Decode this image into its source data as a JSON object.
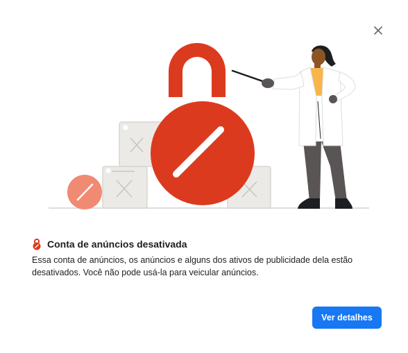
{
  "dialog": {
    "close_icon": "close-icon",
    "title_icon": "lock-alert-icon",
    "title": "Conta de anúncios desativada",
    "description": "Essa conta de anúncios, os anúncios e alguns dos ativos de publicidade dela estão desativados. Você não pode usá-la para veicular anúncios.",
    "details_button": "Ver detalhes"
  },
  "colors": {
    "accent": "#1877f2",
    "lock_red": "#dc3a1e",
    "small_circle": "#f08a72",
    "box_fill": "#eceae7",
    "skin": "#8d5524",
    "shirt": "#f8b54a",
    "pants": "#5a5555",
    "coat": "#ffffff"
  }
}
